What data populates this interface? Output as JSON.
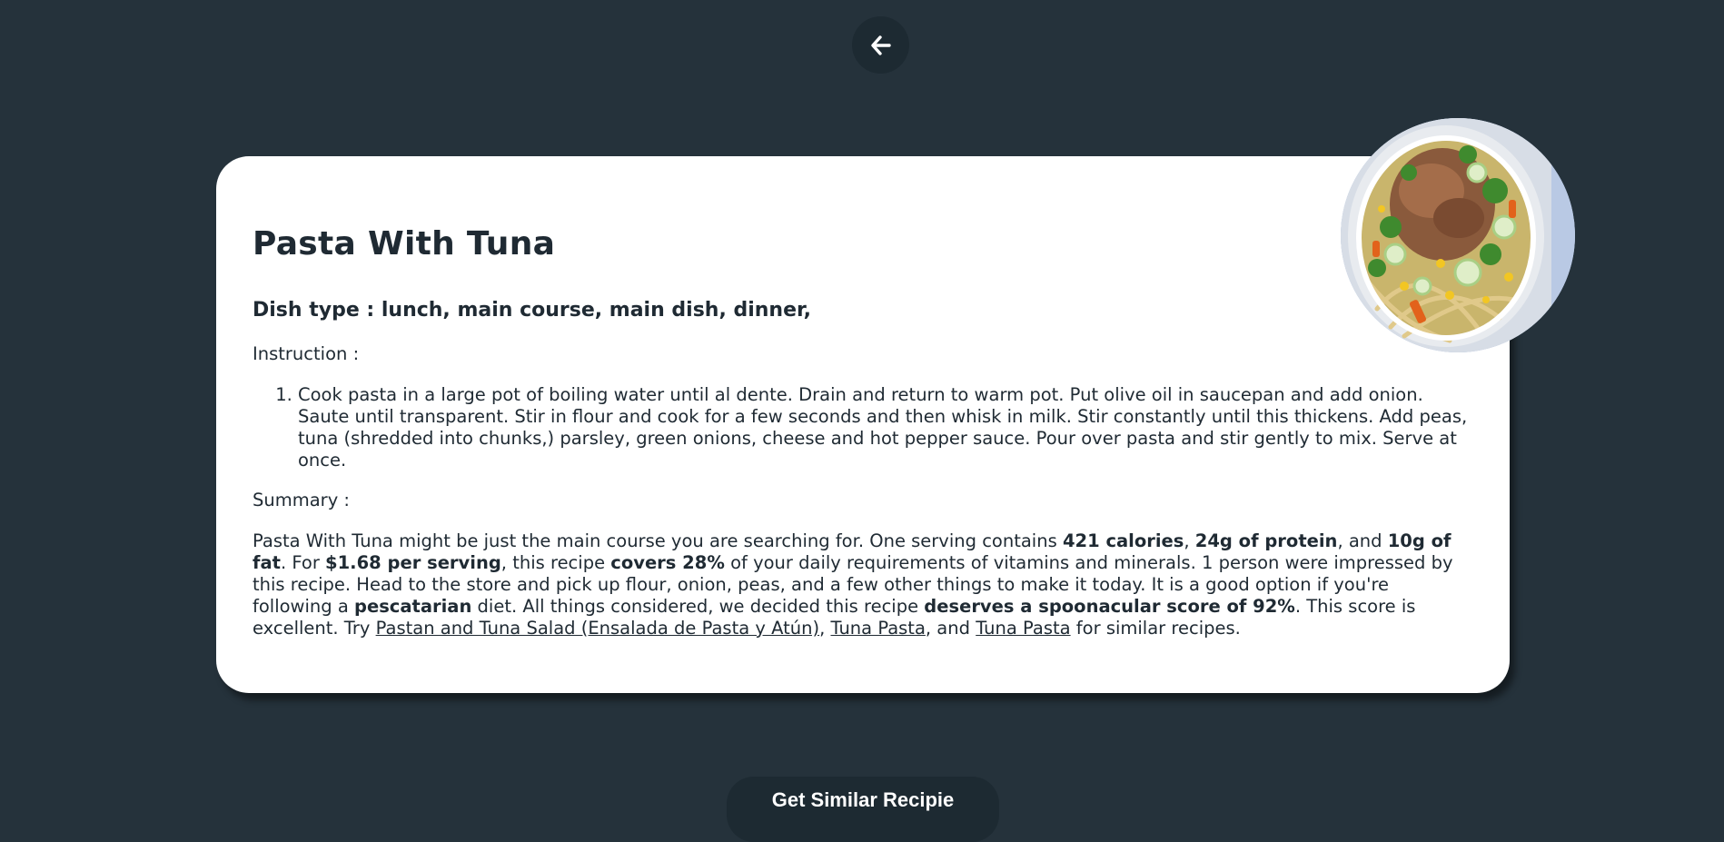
{
  "nav": {
    "back_icon": "arrow-left-icon"
  },
  "recipe": {
    "title": "Pasta With Tuna",
    "dish_type": "Dish type : lunch, main course, main dish, dinner,",
    "instruction_label": "Instruction :",
    "instructions": [
      "Cook pasta in a large pot of boiling water until al dente. Drain and return to warm pot. Put olive oil in saucepan and add onion. Saute until transparent. Stir in flour and cook for a few seconds and then whisk in milk. Stir constantly until this thickens. Add peas, tuna (shredded into chunks,) parsley, green onions, cheese and hot pepper sauce. Pour over pasta and stir gently to mix. Serve at once."
    ],
    "summary_label": "Summary :",
    "summary": {
      "t1": "Pasta With Tuna might be just the main course you are searching for. One serving contains ",
      "b1": "421 calories",
      "t2": ", ",
      "b2": "24g of protein",
      "t3": ", and ",
      "b3": "10g of fat",
      "t4": ". For ",
      "b4": "$1.68 per serving",
      "t5": ", this recipe ",
      "b5": "covers 28%",
      "t6": " of your daily requirements of vitamins and minerals. 1 person were impressed by this recipe. Head to the store and pick up flour, onion, peas, and a few other things to make it today. It is a good option if you're following a ",
      "b6": "pescatarian",
      "t7": " diet. All things considered, we decided this recipe ",
      "b7": "deserves a spoonacular score of 92%",
      "t8": ". This score is excellent. Try ",
      "l1": "Pastan and Tuna Salad (Ensalada de Pasta y Atún)",
      "t9": ", ",
      "l2": "Tuna Pasta",
      "t10": ", and ",
      "l3": "Tuna Pasta",
      "t11": " for similar recipes."
    }
  },
  "actions": {
    "similar_label": "Get Similar Recipie"
  },
  "colors": {
    "background": "#25323b",
    "button_bg": "#1d2a32",
    "card_bg": "#ffffff",
    "text": "#1f2a33"
  }
}
